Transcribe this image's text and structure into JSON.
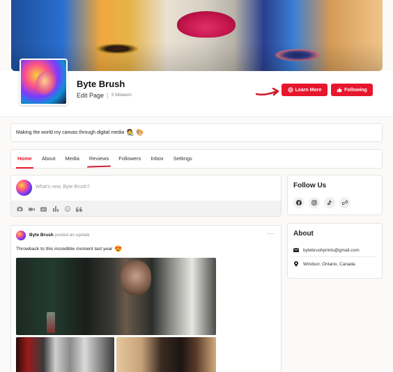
{
  "header": {
    "page_name": "Byte Brush",
    "edit_page": "Edit Page",
    "followers": "5 followers",
    "learn_more_label": "Learn More",
    "following_label": "Following"
  },
  "bio": {
    "text": "Making the world my canvas through digital media",
    "emojis": "🧑‍🎨 🎨"
  },
  "tabs": [
    {
      "label": "Home",
      "active": true
    },
    {
      "label": "About"
    },
    {
      "label": "Media"
    },
    {
      "label": "Reviews"
    },
    {
      "label": "Followers"
    },
    {
      "label": "Inbox"
    },
    {
      "label": "Settings"
    }
  ],
  "composer": {
    "placeholder": "What's new, Byte Brush?",
    "tools": [
      "camera-icon",
      "video-icon",
      "gif-icon",
      "poll-icon",
      "emoji-icon",
      "quote-icon"
    ]
  },
  "post": {
    "author": "Byte Brush",
    "action": "posted an update",
    "text": "Throwback to this incredible moment last year",
    "emoji": "😍",
    "menu": "···"
  },
  "follow_us": {
    "title": "Follow Us",
    "icons": [
      "facebook-icon",
      "instagram-icon",
      "tiktok-icon",
      "link-icon"
    ]
  },
  "about": {
    "title": "About",
    "email": "bytebrushprints@gmail.com",
    "location": "Windsor, Ontario, Canada"
  },
  "colors": {
    "accent": "#e8162c",
    "background": "#fbfaf8"
  }
}
